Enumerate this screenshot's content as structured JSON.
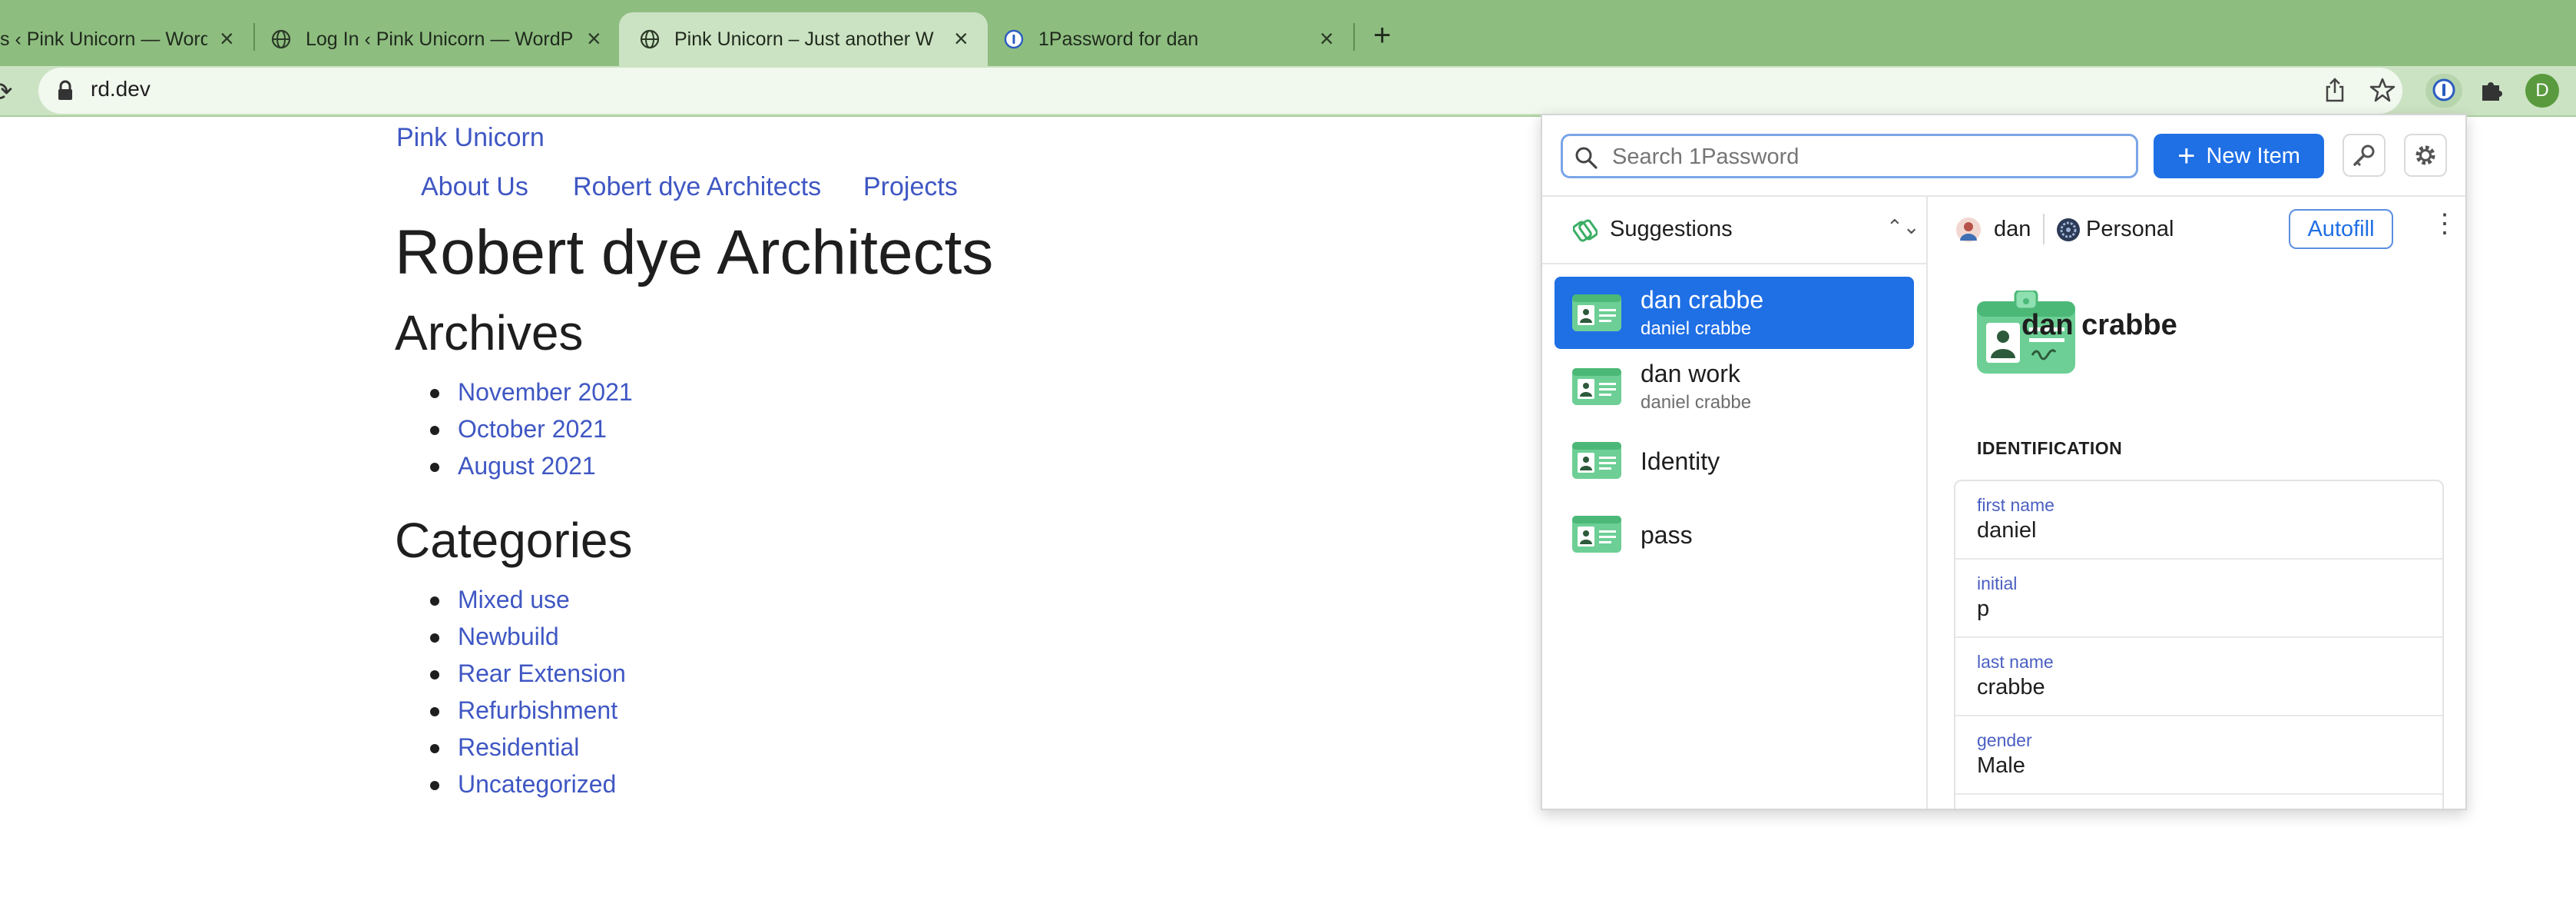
{
  "browser": {
    "tabs": [
      {
        "title": "s ‹ Pink Unicorn — Word",
        "active": false
      },
      {
        "title": "Log In ‹ Pink Unicorn — WordP",
        "active": false
      },
      {
        "title": "Pink Unicorn – Just another W",
        "active": true
      },
      {
        "title": "1Password for dan",
        "active": false
      }
    ],
    "new_tab": "+",
    "url": "rd.dev",
    "profile_initial": "D",
    "colors": {
      "frame": "#8ebd80",
      "toolbar": "#cce3c3"
    }
  },
  "page": {
    "site_title": "Pink Unicorn",
    "nav": [
      "About Us",
      "Robert dye Architects",
      "Projects"
    ],
    "heading": "Robert dye Architects",
    "archives": {
      "title": "Archives",
      "items": [
        "November 2021",
        "October 2021",
        "August 2021"
      ]
    },
    "categories": {
      "title": "Categories",
      "items": [
        "Mixed use",
        "Newbuild",
        "Rear Extension",
        "Refurbishment",
        "Residential",
        "Uncategorized"
      ]
    }
  },
  "onepassword": {
    "search_placeholder": "Search 1Password",
    "new_item_label": "New Item",
    "filter_label": "Suggestions",
    "items": [
      {
        "title": "dan crabbe",
        "subtitle": "daniel crabbe",
        "selected": true
      },
      {
        "title": "dan work",
        "subtitle": "daniel crabbe",
        "selected": false
      },
      {
        "title": "Identity",
        "subtitle": "",
        "selected": false
      },
      {
        "title": "pass",
        "subtitle": "",
        "selected": false
      }
    ],
    "account_user": "dan",
    "vault": "Personal",
    "autofill_label": "Autofill",
    "detail": {
      "title": "dan crabbe",
      "section": "IDENTIFICATION",
      "fields": [
        {
          "label": "first name",
          "value": "daniel"
        },
        {
          "label": "initial",
          "value": "p"
        },
        {
          "label": "last name",
          "value": "crabbe"
        },
        {
          "label": "gender",
          "value": "Male"
        }
      ]
    },
    "colors": {
      "accent": "#1f6fe5",
      "field_label": "#4a5fc1",
      "identity_icon": "#5cc28c"
    }
  }
}
